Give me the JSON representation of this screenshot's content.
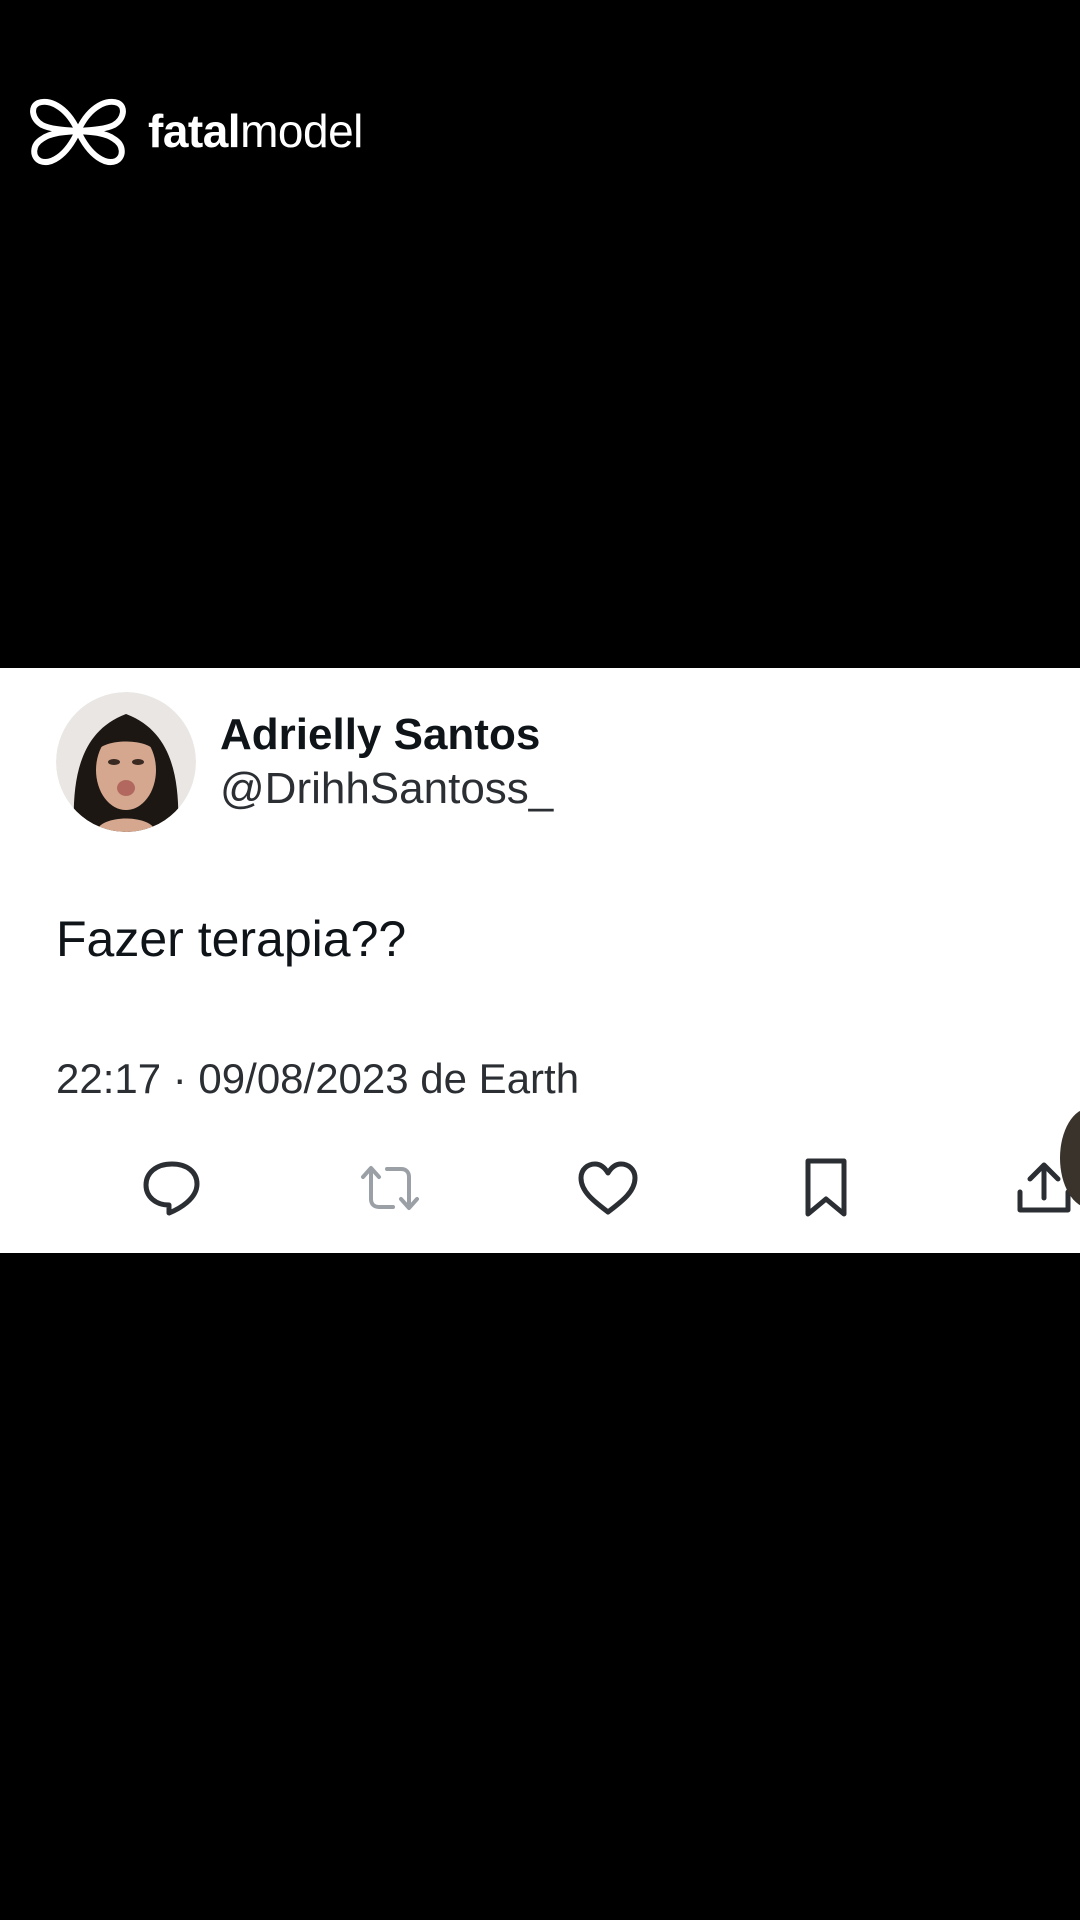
{
  "brand": {
    "name_bold": "fatal",
    "name_light": "model",
    "logo_icon": "butterfly-logo-icon"
  },
  "tweet": {
    "display_name": "Adrielly Santos",
    "handle": "@DrihhSantoss_",
    "text": "Fazer terapia??",
    "meta": "22:17 · 09/08/2023 de Earth",
    "avatar_icon": "avatar-photo",
    "actions": [
      {
        "name": "reply",
        "icon": "reply-icon"
      },
      {
        "name": "retweet",
        "icon": "retweet-icon"
      },
      {
        "name": "like",
        "icon": "heart-icon"
      },
      {
        "name": "bookmark",
        "icon": "bookmark-icon"
      },
      {
        "name": "share",
        "icon": "share-icon"
      }
    ]
  },
  "colors": {
    "background": "#000000",
    "card": "#ffffff",
    "text": "#0f1419",
    "icon": "#2b2f33"
  }
}
